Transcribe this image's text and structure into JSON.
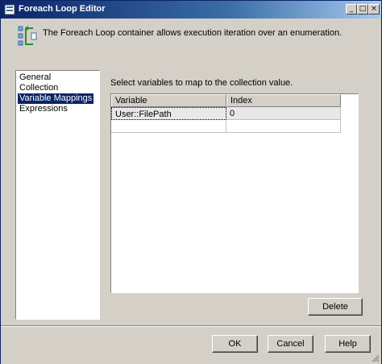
{
  "window": {
    "title": "Foreach Loop Editor",
    "controls": {
      "minimize": "_",
      "maximize": "□",
      "close": "×"
    }
  },
  "header": {
    "description": "The Foreach Loop container allows execution iteration over an enumeration."
  },
  "nav": {
    "items": [
      {
        "label": "General"
      },
      {
        "label": "Collection"
      },
      {
        "label": "Variable Mappings",
        "selected": true
      },
      {
        "label": "Expressions"
      }
    ]
  },
  "main": {
    "instruction": "Select variables to map to the collection value.",
    "grid": {
      "columns": [
        "Variable",
        "Index"
      ],
      "rows": [
        {
          "variable": "User::FilePath",
          "index": "0"
        }
      ]
    },
    "delete_label": "Delete"
  },
  "footer": {
    "ok_label": "OK",
    "cancel_label": "Cancel",
    "help_label": "Help"
  },
  "colors": {
    "title_bar": "#0a246a",
    "dialog_bg": "#d4d0c8",
    "selection": "#0a246a"
  }
}
